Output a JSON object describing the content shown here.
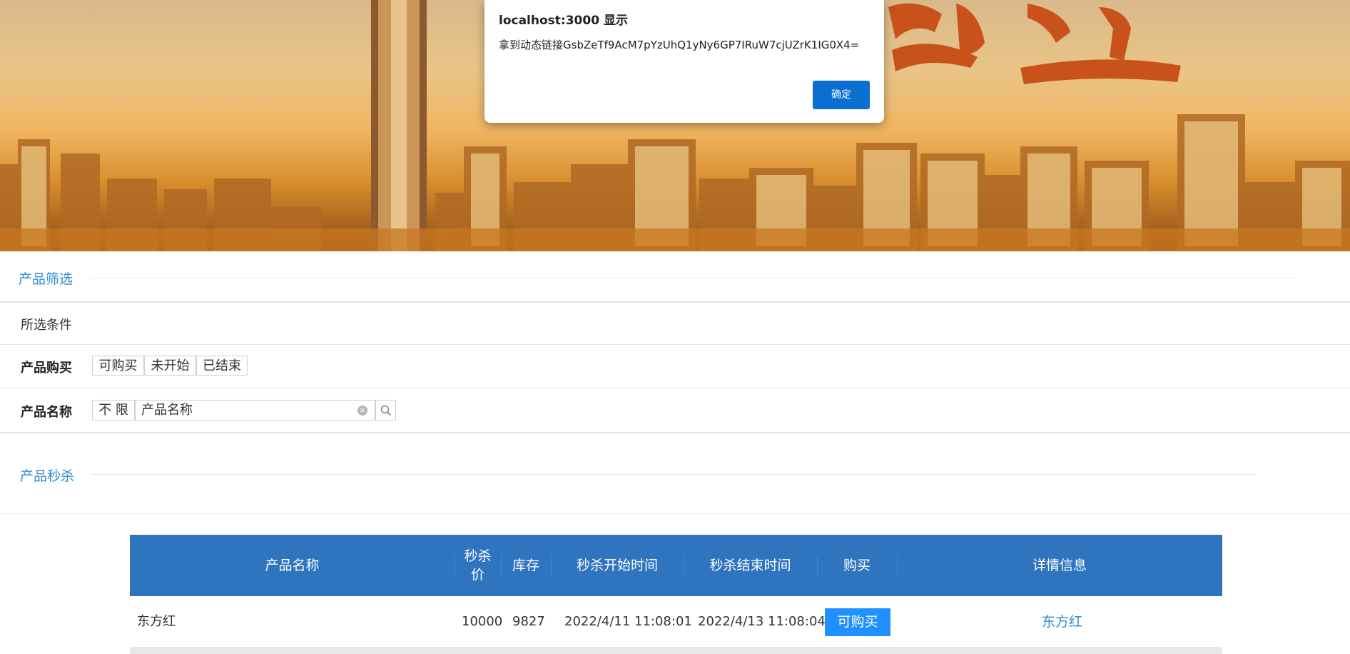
{
  "dialog": {
    "title": "localhost:3000 显示",
    "message": "拿到动态链接GsbZeTf9AcM7pYzUhQ1yNy6GP7IRuW7cjUZrK1IG0X4=",
    "ok_label": "确定"
  },
  "filter": {
    "section_title": "产品筛选",
    "selected_label": "所选条件",
    "purchase_label": "产品购买",
    "purchase_options": [
      "可购买",
      "未开始",
      "已结束"
    ],
    "name_label": "产品名称",
    "name_unlimited": "不 限",
    "name_input_value": "产品名称"
  },
  "seckill": {
    "section_title": "产品秒杀",
    "columns": [
      "产品名称",
      "秒杀价",
      "库存",
      "秒杀开始时间",
      "秒杀结束时间",
      "购买",
      "详情信息"
    ],
    "rows": [
      {
        "name": "东方红",
        "price": "10000",
        "stock": "9827",
        "start": "2022/4/11 11:08:01",
        "end": "2022/4/13 11:08:04",
        "buy_label": "可购买",
        "detail": "东方红"
      }
    ]
  },
  "colors": {
    "accent": "#2d8cd0",
    "table_header": "#2f74bf",
    "buy_button": "#1e90ff",
    "dialog_button": "#0b6fd1"
  }
}
